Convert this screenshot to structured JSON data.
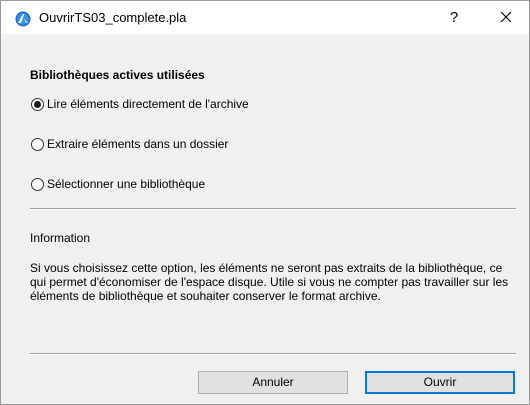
{
  "window": {
    "title": "OuvrirTS03_complete.pla",
    "help_label": "?",
    "close_icon": "close-icon",
    "app_icon": "archicad-icon"
  },
  "libraries": {
    "title": "Bibliothèques actives utilisées",
    "options": [
      {
        "label": "Lire éléments directement de l'archive",
        "selected": true
      },
      {
        "label": "Extraire éléments dans un dossier",
        "selected": false
      },
      {
        "label": "Sélectionner une bibliothèque",
        "selected": false
      }
    ]
  },
  "information": {
    "title": "Information",
    "text": "Si vous choisissez cette option, les éléments ne seront pas extraits de la bibliothèque, ce qui permet d'économiser de l'espace disque. Utile si vous ne compter pas travailler sur les éléments de bibliothèque et souhaiter conserver le format archive."
  },
  "buttons": {
    "cancel_label": "Annuler",
    "open_label": "Ouvrir"
  },
  "colors": {
    "dialog_background": "#f0f0f0",
    "accent": "#0078d7"
  }
}
